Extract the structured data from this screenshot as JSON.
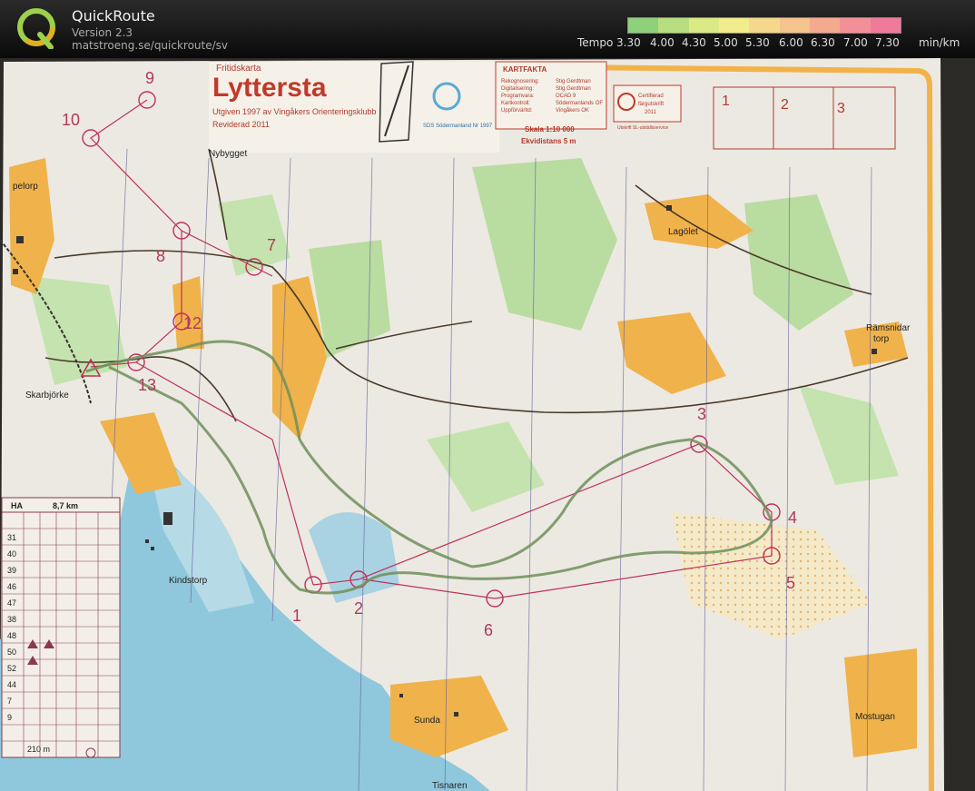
{
  "app": {
    "name": "QuickRoute",
    "version": "Version 2.3",
    "url": "matstroeng.se/quickroute/sv"
  },
  "tempo": {
    "label": "Tempo",
    "ticks": [
      "3.30",
      "4.00",
      "4.30",
      "5.00",
      "5.30",
      "6.00",
      "6.30",
      "7.00",
      "7.30"
    ],
    "unit": "min/km",
    "colors": [
      "#8fd07a",
      "#b7df80",
      "#dcea86",
      "#f1ec8c",
      "#f6d88d",
      "#f5c38c",
      "#f3aa8f",
      "#f29097",
      "#f07a9a"
    ]
  },
  "map": {
    "header": {
      "subtitle": "Fritidskarta",
      "title": "Lyttersta",
      "line1": "Utgiven 1997 av Vingåkers Orienteringsklubb",
      "line2": "Reviderad 2011"
    },
    "kartfakta": {
      "title": "KARTFAKTA",
      "rows": [
        "Rekognosering:",
        "Digitalisering:",
        "Programvara:",
        "Kartkontroll:",
        "Uppförvärltd:"
      ],
      "values": [
        "Stig Gerdtman",
        "Stig Gerdtman",
        "OCAD 9",
        "Södermanlands OF",
        "Vingåkers OK"
      ]
    },
    "scale": "Skala  1:10 000",
    "contour": "Ekvidistans  5 m",
    "cert": [
      "Certifierad",
      "färgutskrift",
      "2011"
    ],
    "cert_sub": "Utskrift SL-utställsservice",
    "sds": "SDS Södermanland  Nr 1997",
    "boxes": [
      "1",
      "2",
      "3"
    ],
    "places": [
      "Nybygget",
      "Lagölet",
      "Rämsnidar",
      "torp",
      "Skarbjörke",
      "Kindstorp",
      "Sunda",
      "Tisnaren",
      "Mostugan",
      "pelorp"
    ],
    "controls": [
      "1",
      "2",
      "3",
      "4",
      "5",
      "6",
      "7",
      "8",
      "9",
      "10",
      "12",
      "13"
    ],
    "description": {
      "class": "HA",
      "length": "8,7 km",
      "codes": [
        "31",
        "40",
        "39",
        "46",
        "47",
        "38",
        "48",
        "50",
        "52",
        "44",
        "7",
        "9"
      ],
      "finish": "210 m"
    }
  }
}
